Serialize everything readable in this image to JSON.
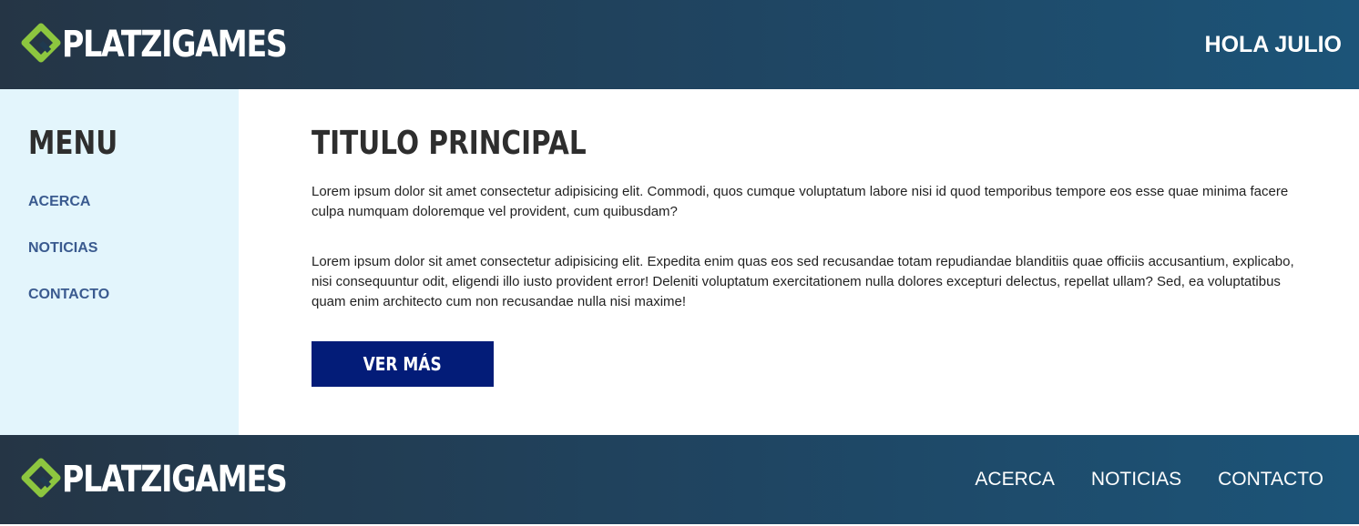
{
  "header": {
    "brand": "PLATZIGAMES",
    "logo_icon": "platzi-logo-icon",
    "greeting": "HOLA JULIO"
  },
  "sidebar": {
    "title": "MENU",
    "items": [
      {
        "label": "ACERCA"
      },
      {
        "label": "NOTICIAS"
      },
      {
        "label": "CONTACTO"
      }
    ]
  },
  "main": {
    "title": "TITULO PRINCIPAL",
    "paragraphs": [
      "Lorem ipsum dolor sit amet consectetur adipisicing elit. Commodi, quos cumque voluptatum labore nisi id quod temporibus tempore eos esse quae minima facere culpa numquam doloremque vel provident, cum quibusdam?",
      "Lorem ipsum dolor sit amet consectetur adipisicing elit. Expedita enim quas eos sed recusandae totam repudiandae blanditiis quae officiis accusantium, explicabo, nisi consequuntur odit, eligendi illo iusto provident error! Deleniti voluptatum exercitationem nulla dolores excepturi delectus, repellat ullam? Sed, ea voluptatibus quam enim architecto cum non recusandae nulla nisi maxime!"
    ],
    "button_label": "VER MÁS"
  },
  "footer": {
    "brand": "PLATZIGAMES",
    "logo_icon": "platzi-logo-icon",
    "nav": [
      {
        "label": "ACERCA"
      },
      {
        "label": "NOTICIAS"
      },
      {
        "label": "CONTACTO"
      }
    ]
  },
  "colors": {
    "bar_gradient_start": "#253545",
    "bar_gradient_end": "#1c5478",
    "logo_green": "#8dc63f",
    "sidebar_bg": "#e3f5fc",
    "sidebar_link": "#3a5a8f",
    "button_bg": "#031c78",
    "title_text": "#2e2e2e"
  }
}
